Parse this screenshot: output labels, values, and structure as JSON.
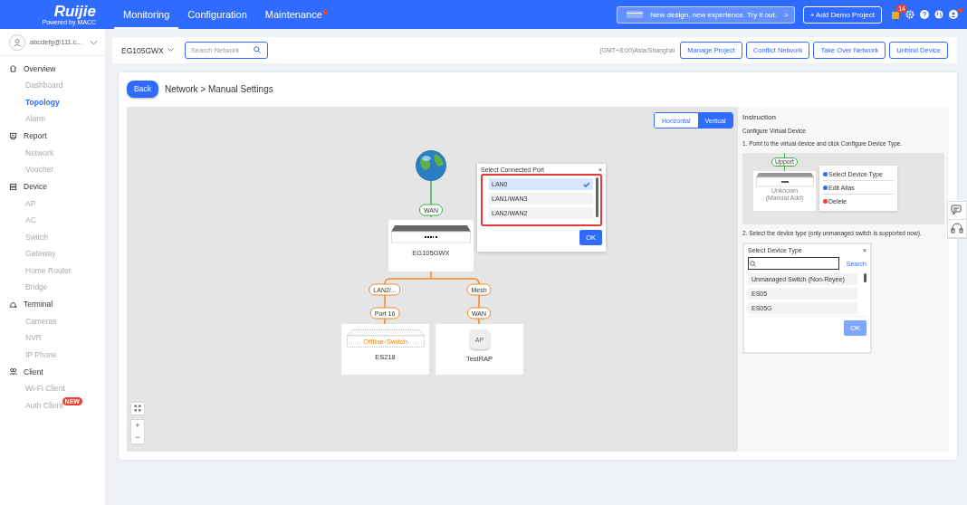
{
  "header": {
    "logo": "Ruijie",
    "logo_sub": "Powered by MACC",
    "nav": [
      {
        "label": "Monitoring",
        "selected": true,
        "dot": false
      },
      {
        "label": "Configuration",
        "selected": false,
        "dot": false
      },
      {
        "label": "Maintenance",
        "selected": false,
        "dot": true
      }
    ],
    "promo": "New design, new experience. Try it out.",
    "promo_arrow": ">",
    "demo_button": "+ Add Demo Project",
    "notification_count": "14",
    "account_dot": true
  },
  "sidebar": {
    "account": "abcdefg@111.c...",
    "groups": [
      {
        "label": "Overview",
        "items": [
          {
            "label": "Dashboard",
            "selected": false
          },
          {
            "label": "Topology",
            "selected": true
          },
          {
            "label": "Alarm",
            "selected": false
          }
        ]
      },
      {
        "label": "Report",
        "items": [
          {
            "label": "Network",
            "selected": false
          },
          {
            "label": "Voucher",
            "selected": false
          }
        ]
      },
      {
        "label": "Device",
        "items": [
          {
            "label": "AP",
            "selected": false
          },
          {
            "label": "AC",
            "selected": false
          },
          {
            "label": "Switch",
            "selected": false
          },
          {
            "label": "Gateway",
            "selected": false
          },
          {
            "label": "Home Router",
            "selected": false
          },
          {
            "label": "Bridge",
            "selected": false
          }
        ]
      },
      {
        "label": "Terminal",
        "items": [
          {
            "label": "Cameras",
            "selected": false
          },
          {
            "label": "NVR",
            "selected": false
          },
          {
            "label": "IP Phone",
            "selected": false
          }
        ]
      },
      {
        "label": "Client",
        "items": [
          {
            "label": "Wi-Fi Client",
            "selected": false
          },
          {
            "label": "Auth Client",
            "selected": false,
            "badge": "NEW"
          }
        ]
      }
    ]
  },
  "toolbar": {
    "network": "EG105GWX",
    "search_placeholder": "Search Network",
    "timezone": "(GMT+8:00)Asia/Shanghai",
    "buttons": [
      "Manage Project",
      "Conflict Network",
      "Take Over Network",
      "Unbind Device"
    ]
  },
  "page": {
    "back": "Back",
    "breadcrumb": "Network > Manual Settings"
  },
  "topology": {
    "layout_toggle": [
      {
        "label": "Horizontal",
        "selected": false
      },
      {
        "label": "Vertical",
        "selected": true
      }
    ],
    "root_port": "WAN",
    "gateway": "EG105GWX",
    "links": [
      {
        "uplink": "LAN2/...",
        "downlink": "Port 16",
        "device": "ES218",
        "kind": "switch",
        "status": "Offline-Switch"
      },
      {
        "uplink": "Mesh",
        "downlink": "WAN",
        "device": "TestRAP",
        "kind": "ap",
        "ap_label": "AP"
      }
    ],
    "port_popup": {
      "title": "Select Connected Port",
      "close": "×",
      "ports": [
        {
          "label": "LAN0",
          "selected": true
        },
        {
          "label": "LAN1/WAN3",
          "selected": false
        },
        {
          "label": "LAN2/WAN2",
          "selected": false
        }
      ],
      "ok": "OK"
    },
    "zoom": {
      "zoom_in": "+",
      "zoom_out": "−"
    }
  },
  "instruction": {
    "title": "Instruction",
    "subtitle": "Configure Virtual Device",
    "step1": "1. Point to the virtual device and click Configure Device Type.",
    "example": {
      "uplink": "Upport",
      "device": "Unknown",
      "device_note": "(Manual Add)",
      "menu": [
        {
          "label": "Select Device Type",
          "color": "#2f6bff"
        },
        {
          "label": "Edit Alias",
          "color": "#2f6bff"
        },
        {
          "label": "Delete",
          "color": "#f0412f"
        }
      ]
    },
    "step2": "2. Select the device type (only unmanaged switch is supported now).",
    "dialog": {
      "title": "Select Device Type",
      "close": "×",
      "search_button": "Search",
      "options": [
        "Unmanaged Switch (Non-Reyee)",
        "ES05",
        "ES05G"
      ],
      "ok": "OK",
      "ok_disabled": true
    }
  }
}
